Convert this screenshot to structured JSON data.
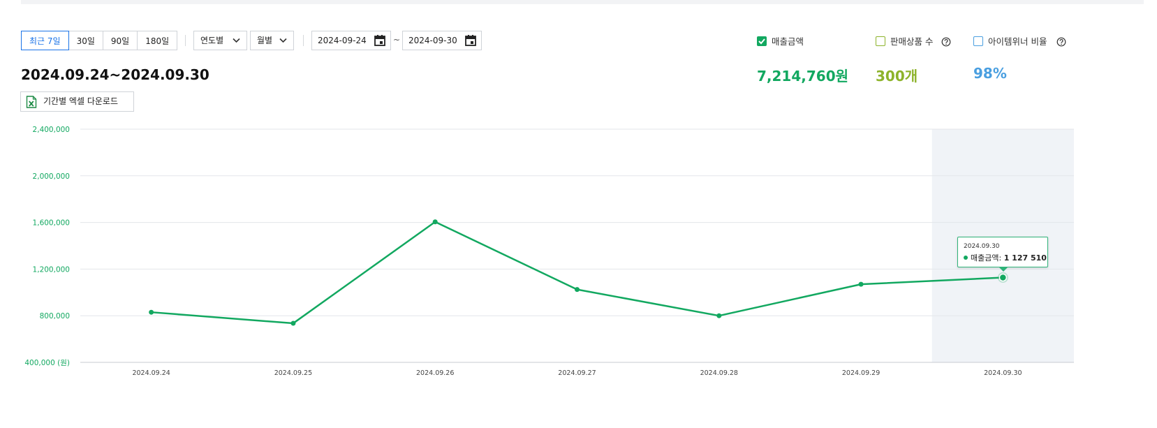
{
  "period_buttons": [
    {
      "label": "최근 7일",
      "active": true
    },
    {
      "label": "30일",
      "active": false
    },
    {
      "label": "90일",
      "active": false
    },
    {
      "label": "180일",
      "active": false
    }
  ],
  "dropdowns": {
    "yearly": "연도별",
    "monthly": "월별"
  },
  "date_range": {
    "start": "2024-09-24",
    "separator": "~",
    "end": "2024-09-30"
  },
  "range_title": "2024.09.24~2024.09.30",
  "excel_button": "기간별 엑셀 다운로드",
  "metrics": [
    {
      "label": "매출금액",
      "checked": true,
      "value": "7,214,760원",
      "color": "#12a860",
      "help": false
    },
    {
      "label": "판매상품 수",
      "checked": false,
      "value": "300개",
      "color": "#8db32b",
      "help": true
    },
    {
      "label": "아이템위너 비율",
      "checked": false,
      "value": "98%",
      "color": "#4a9fe0",
      "help": true
    }
  ],
  "chart_data": {
    "type": "line",
    "categories": [
      "2024.09.24",
      "2024.09.25",
      "2024.09.26",
      "2024.09.27",
      "2024.09.28",
      "2024.09.29",
      "2024.09.30"
    ],
    "series": [
      {
        "name": "매출금액",
        "color": "#12a860",
        "values": [
          830000,
          735000,
          1605000,
          1025000,
          800000,
          1070000,
          1127510
        ]
      }
    ],
    "y_ticks": [
      "2,400,000",
      "2,000,000",
      "1,600,000",
      "1,200,000",
      "800,000",
      "400,000 (원)"
    ],
    "ylim": [
      400000,
      2400000
    ],
    "highlighted_index": 6,
    "grid": true,
    "tooltip": {
      "date": "2024.09.30",
      "label": "매출금액",
      "value": "1 127 510"
    }
  }
}
